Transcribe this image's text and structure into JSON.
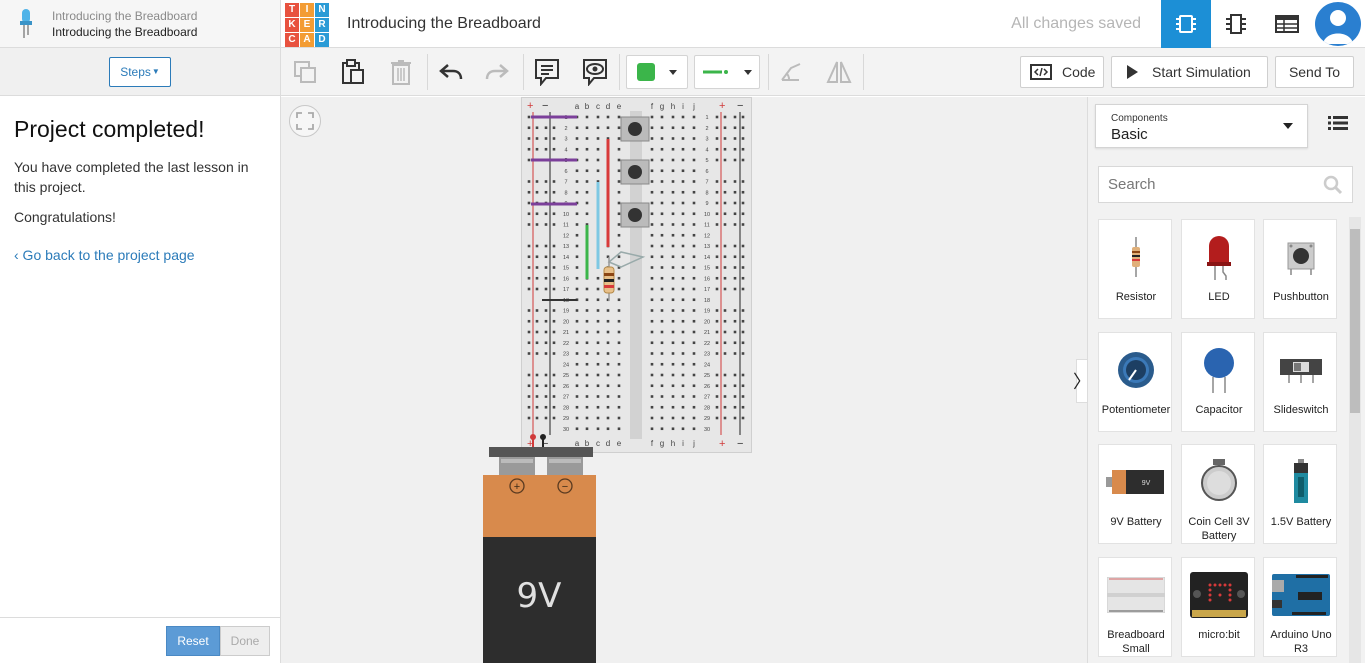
{
  "lesson": {
    "header_title_1": "Introducing the Breadboard",
    "header_title_2": "Introducing the Breadboard",
    "steps_label": "Steps",
    "heading": "Project completed!",
    "text_1": "You have completed the last lesson in this project.",
    "text_2": "Congratulations!",
    "back_link": "‹ Go back to the project page",
    "reset_label": "Reset",
    "done_label": "Done"
  },
  "header": {
    "logo_letters": [
      "T",
      "I",
      "N",
      "K",
      "E",
      "R",
      "C",
      "A",
      "D"
    ],
    "title": "Introducing the Breadboard",
    "save_status": "All changes saved",
    "active_view": "circuit"
  },
  "toolbar": {
    "code_label": "Code",
    "simulate_label": "Start Simulation",
    "send_label": "Send To",
    "fill_color": "#3bb54a",
    "wire_color": "#3bb54a"
  },
  "breadboard": {
    "left_cols": [
      "a",
      "b",
      "c",
      "d",
      "e"
    ],
    "right_cols": [
      "f",
      "g",
      "h",
      "i",
      "j"
    ],
    "rows": 30,
    "rail_plus": "+",
    "rail_minus": "−"
  },
  "battery": {
    "label": "9V",
    "plus": "+",
    "minus": "−"
  },
  "components": {
    "select_label": "Components",
    "select_value": "Basic",
    "search_placeholder": "Search",
    "items": [
      {
        "name": "Resistor",
        "icon": "resistor-icon"
      },
      {
        "name": "LED",
        "icon": "led-icon"
      },
      {
        "name": "Pushbutton",
        "icon": "pushbutton-icon"
      },
      {
        "name": "Potentiometer",
        "icon": "potentiometer-icon"
      },
      {
        "name": "Capacitor",
        "icon": "capacitor-icon"
      },
      {
        "name": "Slideswitch",
        "icon": "slideswitch-icon"
      },
      {
        "name": "9V Battery",
        "icon": "9v-battery-icon"
      },
      {
        "name": "Coin Cell 3V Battery",
        "icon": "coin-cell-icon"
      },
      {
        "name": "1.5V Battery",
        "icon": "aa-battery-icon"
      },
      {
        "name": "Breadboard Small",
        "icon": "breadboard-icon"
      },
      {
        "name": "micro:bit",
        "icon": "microbit-icon"
      },
      {
        "name": "Arduino Uno R3",
        "icon": "arduino-icon"
      }
    ]
  },
  "colors": {
    "accent": "#1c8fd6",
    "link": "#2b7bb9"
  }
}
